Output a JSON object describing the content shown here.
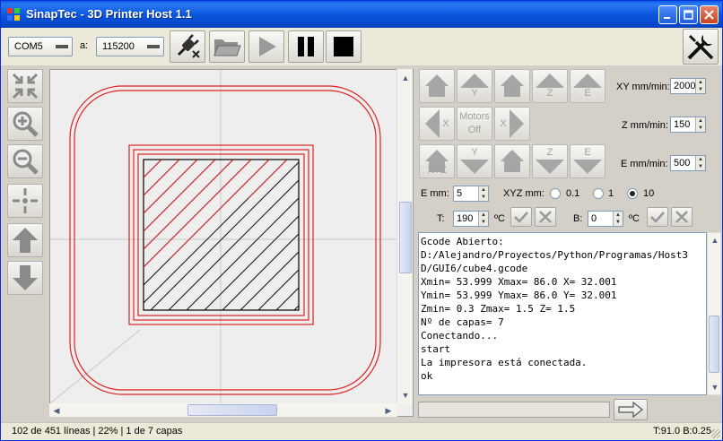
{
  "window": {
    "title": "SinapTec - 3D Printer Host 1.1",
    "title_colors": {
      "bar": "#0a58e0",
      "close": "#c9431f"
    }
  },
  "toolbar": {
    "port_value": "COM5",
    "baud_label": "a:",
    "baud_value": "115200",
    "icons": [
      "disconnect-plug-icon",
      "open-folder-icon",
      "play-icon",
      "pause-icon",
      "stop-icon",
      "tools-icon"
    ]
  },
  "left_tools": [
    "fit-view-icon",
    "zoom-in-icon",
    "zoom-out-icon",
    "center-view-icon",
    "layer-up-icon",
    "layer-down-icon"
  ],
  "jog": {
    "row1": [
      {
        "axis": "X",
        "icon": "home-x-icon"
      },
      {
        "axis": "Y",
        "icon": "y-up-arrow-icon"
      },
      {
        "axis": "Y",
        "icon": "home-y-icon"
      },
      {
        "axis": "Z",
        "icon": "z-up-arrow-icon"
      },
      {
        "axis": "E",
        "icon": "e-up-arrow-icon"
      }
    ],
    "row2": [
      {
        "axis": "X",
        "icon": "x-left-arrow-icon"
      },
      {
        "axis": "Motors\nOff",
        "icon": "motors-off-icon"
      },
      {
        "axis": "X",
        "icon": "x-right-arrow-icon"
      }
    ],
    "row3": [
      {
        "axis": "XYZ",
        "icon": "home-all-icon"
      },
      {
        "axis": "Y",
        "icon": "y-down-arrow-icon"
      },
      {
        "axis": "Z",
        "icon": "home-z-icon"
      },
      {
        "axis": "Z",
        "icon": "z-down-arrow-icon"
      },
      {
        "axis": "E",
        "icon": "e-down-arrow-icon"
      }
    ],
    "motors_line1": "Motors",
    "motors_line2": "Off"
  },
  "speeds": {
    "xy_label": "XY mm/min:",
    "xy_value": "2000",
    "z_label": "Z mm/min:",
    "z_value": "150",
    "e_label": "E mm/min:",
    "e_value": "500"
  },
  "steps": {
    "e_label": "E mm:",
    "e_value": "5",
    "xyz_label": "XYZ mm:",
    "options": [
      "0.1",
      "1",
      "10"
    ],
    "selected": "10"
  },
  "temps": {
    "t_label": "T:",
    "t_value": "190",
    "t_unit": "ºC",
    "b_label": "B:",
    "b_value": "0",
    "b_unit": "ºC"
  },
  "console": {
    "lines": [
      "Gcode Abierto:",
      "D:/Alejandro/Proyectos/Python/Programas/Host3",
      "D/GUI6/cube4.gcode",
      "Xmin= 53.999 Xmax= 86.0 X= 32.001",
      "Ymin= 53.999 Ymax= 86.0 Y= 32.001",
      "Zmin= 0.3 Zmax= 1.5 Z= 1.5",
      "Nº de capas= 7",
      "Conectando...",
      "start",
      "La impresora está conectada.",
      "ok"
    ]
  },
  "status": {
    "left": "102 de 451 líneas | 22% | 1 de 7 capas",
    "right": "T:91.0 B:0.25"
  }
}
